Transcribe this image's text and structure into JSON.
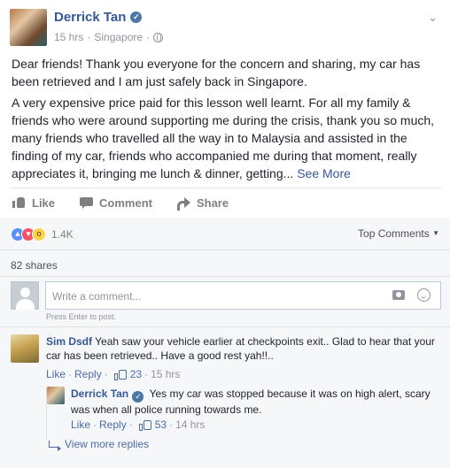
{
  "post": {
    "author": "Derrick Tan",
    "time": "15 hrs",
    "location": "Singapore",
    "paragraph1": "Dear friends! Thank you everyone for the concern and sharing, my car has been retrieved and I am just safely back in Singapore.",
    "paragraph2": "A very expensive price paid for this lesson well learnt. For all my family & friends who were around supporting me during the crisis, thank you so much, many friends who travelled all the way in to Malaysia and assisted in the finding of my car, friends who accompanied me during that moment, really appreciates it, bringing me lunch & dinner, getting...",
    "see_more": "See More"
  },
  "actions": {
    "like": "Like",
    "comment": "Comment",
    "share": "Share"
  },
  "stats": {
    "reactions_count": "1.4K",
    "top_comments": "Top Comments",
    "shares": "82 shares"
  },
  "composer": {
    "placeholder": "Write a comment...",
    "hint": "Press Enter to post."
  },
  "comments": [
    {
      "name": "Sim Dsdf",
      "text": "Yeah saw your vehicle earlier at checkpoints exit.. Glad to hear that your car has been retrieved.. Have a good rest yah!!..",
      "like": "Like",
      "reply": "Reply",
      "likes": "23",
      "time": "15 hrs"
    },
    {
      "name": "Derrick Tan",
      "text": "Yes my car was stopped because it was on high alert, scary was when all police running towards me.",
      "like": "Like",
      "reply": "Reply",
      "likes": "53",
      "time": "14 hrs"
    }
  ],
  "view_more": "View more replies",
  "colors": {
    "link": "#365899",
    "muted": "#90949c",
    "background": "#f6f7f9"
  }
}
